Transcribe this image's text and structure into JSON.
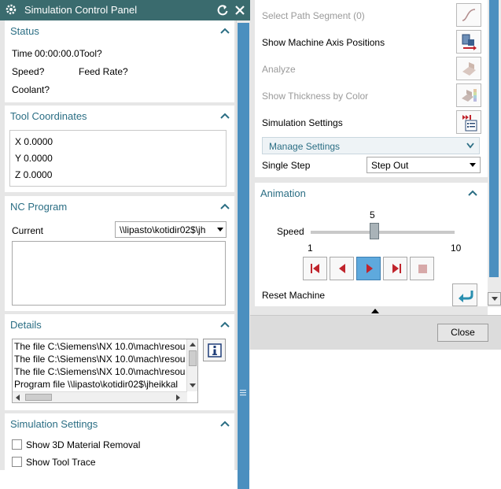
{
  "window": {
    "title": "Simulation Control Panel"
  },
  "status": {
    "header": "Status",
    "time_label": "Time",
    "time_value": "00:00:00.0",
    "tool_label": "Tool?",
    "speed_label": "Speed?",
    "feed_rate_label": "Feed Rate?",
    "coolant_label": "Coolant?"
  },
  "tool_coordinates": {
    "header": "Tool Coordinates",
    "x": "X 0.0000",
    "y": "Y 0.0000",
    "z": "Z 0.0000"
  },
  "nc_program": {
    "header": "NC Program",
    "current_label": "Current",
    "current_value": "\\\\lipasto\\kotidir02$\\jh"
  },
  "details": {
    "header": "Details",
    "lines": [
      "The file C:\\Siemens\\NX 10.0\\mach\\resou",
      "The file C:\\Siemens\\NX 10.0\\mach\\resou",
      "The file C:\\Siemens\\NX 10.0\\mach\\resou",
      "Program file \\\\lipasto\\kotidir02$\\jheikkal"
    ]
  },
  "sim_settings_left": {
    "header": "Simulation Settings",
    "options": [
      "Show 3D Material Removal",
      "Show Tool Trace"
    ]
  },
  "right_panel": {
    "select_path_segment": "Select Path Segment (0)",
    "show_machine_axis": "Show Machine Axis Positions",
    "analyze": "Analyze",
    "show_thickness": "Show Thickness by Color",
    "simulation_settings": "Simulation Settings",
    "manage_settings": "Manage Settings",
    "single_step_label": "Single Step",
    "single_step_value": "Step Out",
    "animation_header": "Animation",
    "speed_label": "Speed",
    "speed_value": "5",
    "speed_min": "1",
    "speed_max": "10",
    "speed_fraction": 0.444,
    "reset_machine": "Reset Machine"
  },
  "footer": {
    "close_label": "Close"
  },
  "colors": {
    "title_bar": "#3a6b6e",
    "section_header_text": "#2b6e84",
    "scroll_thumb": "#4b8fbf",
    "active_button": "#5ea9dd",
    "play_arrow": "#c0242c"
  },
  "icons": [
    "gear-icon",
    "reset-icon",
    "close-icon",
    "chevron-up-icon",
    "chevron-down-icon",
    "info-icon",
    "path-segment-icon",
    "machine-axis-icon",
    "analyze-icon",
    "thickness-color-icon",
    "simulation-settings-icon",
    "reset-machine-icon"
  ]
}
